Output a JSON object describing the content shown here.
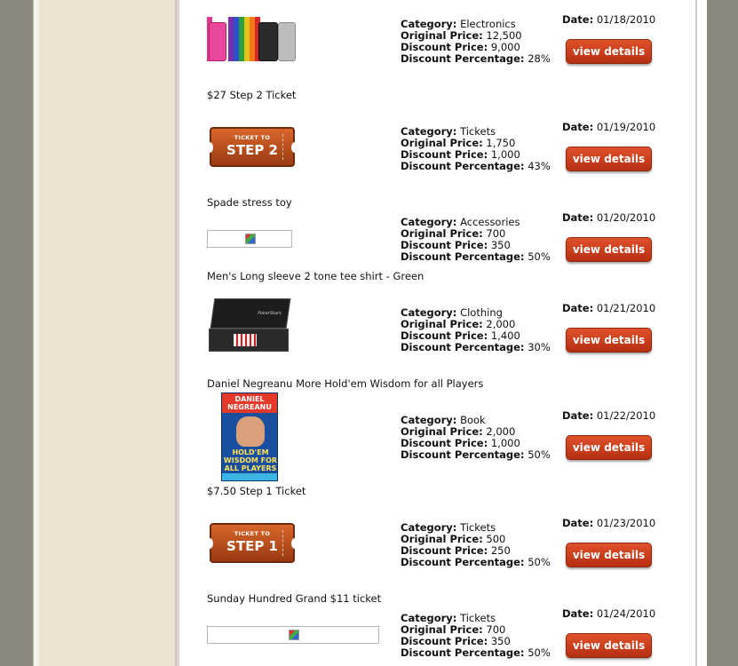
{
  "labels": {
    "category": "Category:",
    "original_price": "Original Price:",
    "discount_price": "Discount Price:",
    "discount_percentage": "Discount Percentage:",
    "date": "Date:",
    "view_details": "view details"
  },
  "items": [
    {
      "title": "",
      "category": "Electronics",
      "original_price": "12,500",
      "discount_price": "9,000",
      "discount_percentage": "28%",
      "date": "01/18/2010",
      "thumb": "ipod-nano-image"
    },
    {
      "title": "$27 Step 2 Ticket",
      "category": "Tickets",
      "original_price": "1,750",
      "discount_price": "1,000",
      "discount_percentage": "43%",
      "date": "01/19/2010",
      "thumb": "ticket-step2-image",
      "ticket_top": "TICKET TO",
      "ticket_text": "STEP 2"
    },
    {
      "title": "Spade stress toy",
      "category": "Accessories",
      "original_price": "700",
      "discount_price": "350",
      "discount_percentage": "50%",
      "date": "01/20/2010",
      "thumb": "broken-image"
    },
    {
      "title": "Men's Long sleeve 2 tone tee shirt - Green",
      "category": "Clothing",
      "original_price": "2,000",
      "discount_price": "1,400",
      "discount_percentage": "30%",
      "date": "01/21/2010",
      "thumb": "poker-case-image"
    },
    {
      "title": "Daniel Negreanu More Hold'em Wisdom for all Players",
      "category": "Book",
      "original_price": "2,000",
      "discount_price": "1,000",
      "discount_percentage": "50%",
      "date": "01/22/2010",
      "thumb": "book-cover-image",
      "book_top": "DANIEL NEGREANU",
      "book_mid": "HOLD'EM WISDOM FOR ALL PLAYERS"
    },
    {
      "title": "$7.50 Step 1 Ticket",
      "category": "Tickets",
      "original_price": "500",
      "discount_price": "250",
      "discount_percentage": "50%",
      "date": "01/23/2010",
      "thumb": "ticket-step1-image",
      "ticket_top": "TICKET TO",
      "ticket_text": "STEP 1"
    },
    {
      "title": "Sunday Hundred Grand $11 ticket",
      "category": "Tickets",
      "original_price": "700",
      "discount_price": "350",
      "discount_percentage": "50%",
      "date": "01/24/2010",
      "thumb": "broken-image"
    }
  ]
}
